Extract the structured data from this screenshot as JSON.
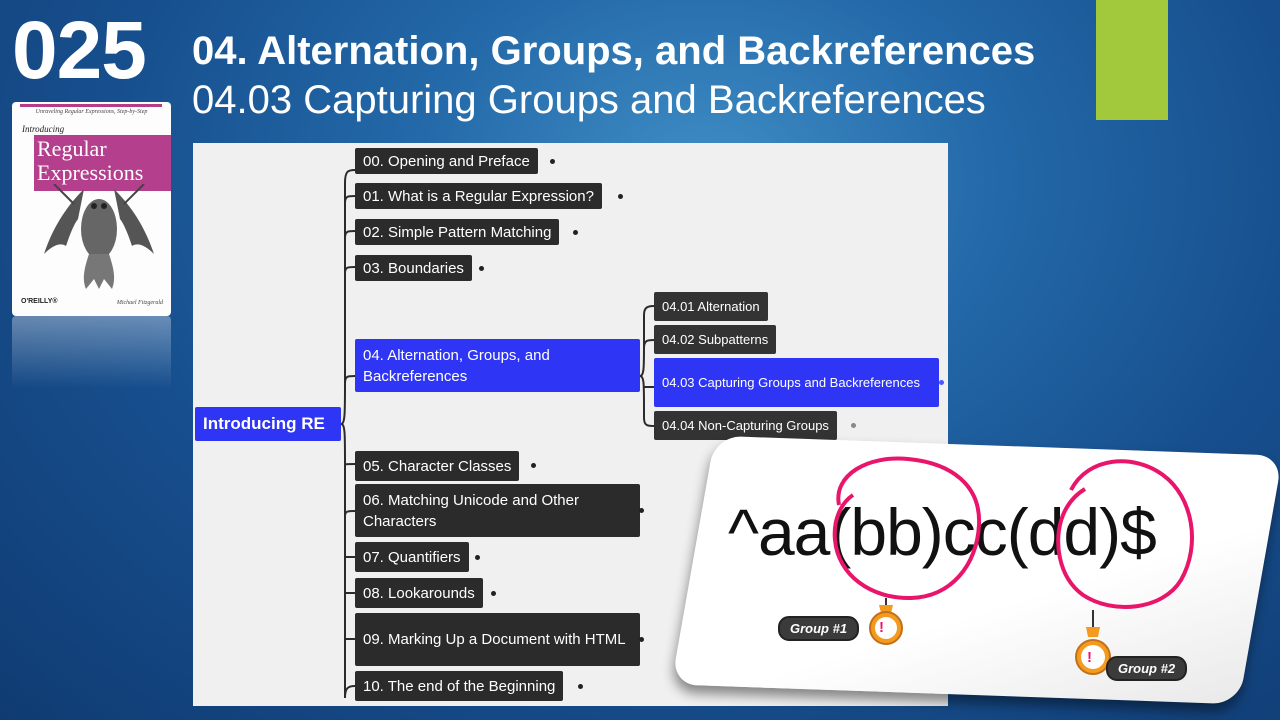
{
  "slide": {
    "number": "025",
    "title": "04. Alternation, Groups, and Backreferences",
    "subtitle": "04.03 Capturing Groups and Backreferences",
    "accent_color": "#a2c83b"
  },
  "book": {
    "tagline": "Unraveling Regular Expressions, Step-by-Step",
    "intro": "Introducing",
    "title_line1": "Regular",
    "title_line2": "Expressions",
    "publisher": "O'REILLY®",
    "author": "Michael Fitzgerald"
  },
  "mindmap": {
    "root": "Introducing RE",
    "chapters": [
      {
        "label": "00. Opening and Preface"
      },
      {
        "label": "01. What is a Regular Expression?"
      },
      {
        "label": "02. Simple Pattern Matching"
      },
      {
        "label": "03. Boundaries"
      },
      {
        "label": "04. Alternation, Groups, and Backreferences"
      },
      {
        "label": "05. Character Classes"
      },
      {
        "label": "06. Matching Unicode and Other Characters"
      },
      {
        "label": "07. Quantifiers"
      },
      {
        "label": "08. Lookarounds"
      },
      {
        "label": "09. Marking Up a Document with HTML"
      },
      {
        "label": "10. The end of the Beginning"
      }
    ],
    "subtopics": [
      {
        "label": "04.01 Alternation"
      },
      {
        "label": "04.02 Subpatterns"
      },
      {
        "label": "04.03 Capturing Groups and Backreferences"
      },
      {
        "label": "04.04 Non-Capturing Groups"
      }
    ],
    "active_color": "#2e35f5"
  },
  "illustration": {
    "regex": "^aa(bb)cc(dd)$",
    "group1": "Group #1",
    "group2": "Group #2",
    "warning_glyph": "!",
    "highlight_color": "#e8156b",
    "badge_color": "#f39a1f"
  }
}
